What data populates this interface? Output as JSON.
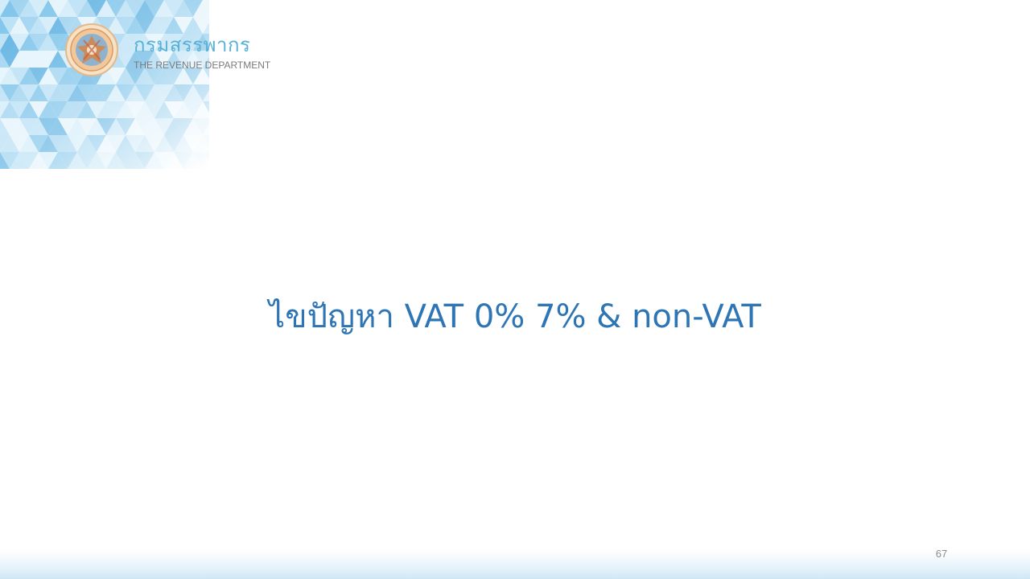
{
  "header": {
    "department_name_thai": "กรมสรรพากร",
    "department_name_en": "THE REVENUE DEPARTMENT",
    "seal_icon": "revenue-department-seal-icon"
  },
  "slide": {
    "title": "ไขปัญหา VAT 0% 7% & non-VAT",
    "page_number": "67"
  },
  "colors": {
    "title": "#2e75b6",
    "brand_thai": "#56b1d6",
    "brand_en": "#7a7a7a",
    "triangle_pattern": "#9fd3f0",
    "footer_band": "#cfe8f6",
    "page_number": "#8c8c8c"
  }
}
